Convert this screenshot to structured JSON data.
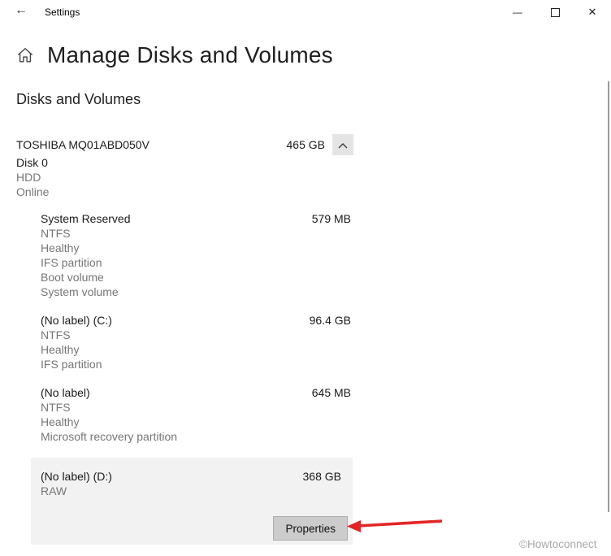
{
  "window": {
    "title": "Settings"
  },
  "icons": {
    "back": "←",
    "minimize": "—",
    "close": "✕"
  },
  "page": {
    "title": "Manage Disks and Volumes",
    "section_title": "Disks and Volumes"
  },
  "disk": {
    "name": "TOSHIBA MQ01ABD050V",
    "size": "465 GB",
    "label": "Disk 0",
    "type": "HDD",
    "status": "Online",
    "volumes": [
      {
        "name": "System Reserved",
        "size": "579 MB",
        "details": [
          "NTFS",
          "Healthy",
          "IFS partition",
          "Boot volume",
          "System volume"
        ],
        "highlighted": false
      },
      {
        "name": "(No label) (C:)",
        "size": "96.4 GB",
        "details": [
          "NTFS",
          "Healthy",
          "IFS partition"
        ],
        "highlighted": false
      },
      {
        "name": "(No label)",
        "size": "645 MB",
        "details": [
          "NTFS",
          "Healthy",
          "Microsoft recovery partition"
        ],
        "highlighted": false
      },
      {
        "name": "(No label) (D:)",
        "size": "368 GB",
        "details": [
          "RAW"
        ],
        "highlighted": true,
        "action_label": "Properties"
      }
    ]
  },
  "watermark": "©Howtoconnect",
  "colors": {
    "highlight_bg": "#f2f2f2",
    "secondary_text": "#767676",
    "button_bg": "#cccccc",
    "arrow_red": "#e42527"
  }
}
